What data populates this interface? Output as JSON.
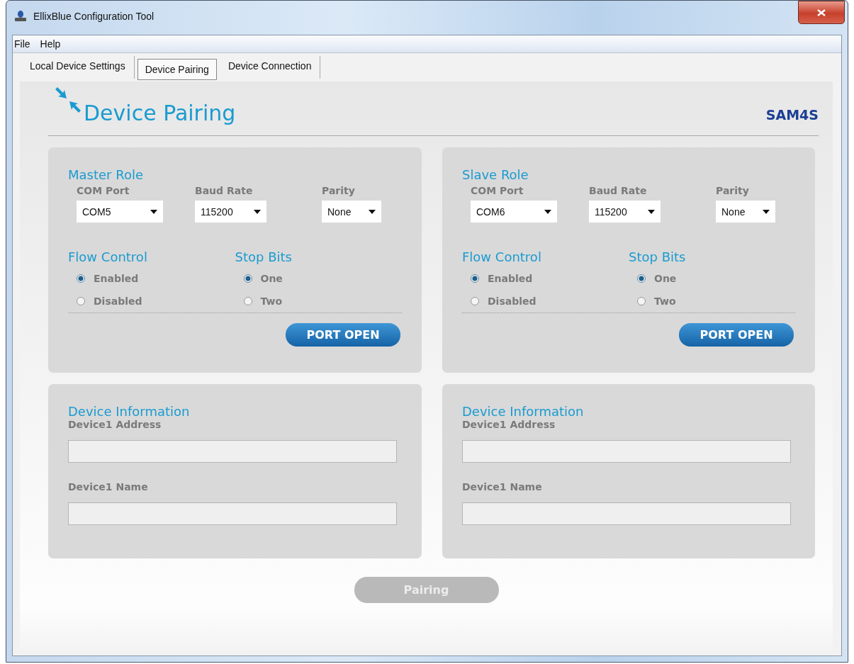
{
  "window": {
    "title": "EllixBlue Configuration Tool"
  },
  "menu": [
    "File",
    "Help"
  ],
  "tabs": [
    {
      "label": "Local Device Settings",
      "selected": false
    },
    {
      "label": "Device Pairing",
      "selected": true
    },
    {
      "label": "Device Connection",
      "selected": false
    }
  ],
  "header": {
    "title": "Device Pairing",
    "logo": "SAM4S"
  },
  "role_panels": [
    {
      "title": "Master Role",
      "dropdowns": [
        {
          "label": "COM Port",
          "value": "COM5"
        },
        {
          "label": "Baud Rate",
          "value": "115200"
        },
        {
          "label": "Parity",
          "value": "None"
        }
      ],
      "groups": [
        {
          "title": "Flow Control",
          "options": [
            {
              "label": "Enabled",
              "selected": true
            },
            {
              "label": "Disabled",
              "selected": false
            }
          ]
        },
        {
          "title": "Stop Bits",
          "options": [
            {
              "label": "One",
              "selected": true
            },
            {
              "label": "Two",
              "selected": false
            }
          ]
        }
      ],
      "button": "PORT OPEN"
    },
    {
      "title": "Slave Role",
      "dropdowns": [
        {
          "label": "COM Port",
          "value": "COM6"
        },
        {
          "label": "Baud Rate",
          "value": "115200"
        },
        {
          "label": "Parity",
          "value": "None"
        }
      ],
      "groups": [
        {
          "title": "Flow Control",
          "options": [
            {
              "label": "Enabled",
              "selected": true
            },
            {
              "label": "Disabled",
              "selected": false
            }
          ]
        },
        {
          "title": "Stop Bits",
          "options": [
            {
              "label": "One",
              "selected": true
            },
            {
              "label": "Two",
              "selected": false
            }
          ]
        }
      ],
      "button": "PORT OPEN"
    }
  ],
  "info_panels": [
    {
      "title": "Device Information",
      "fields": [
        {
          "label": "Device1 Address"
        },
        {
          "label": "Device1 Name"
        }
      ]
    },
    {
      "title": "Device Information",
      "fields": [
        {
          "label": "Device1 Address"
        },
        {
          "label": "Device1 Name"
        }
      ]
    }
  ],
  "pairing_button": {
    "label": "Pairing",
    "disabled": true
  }
}
